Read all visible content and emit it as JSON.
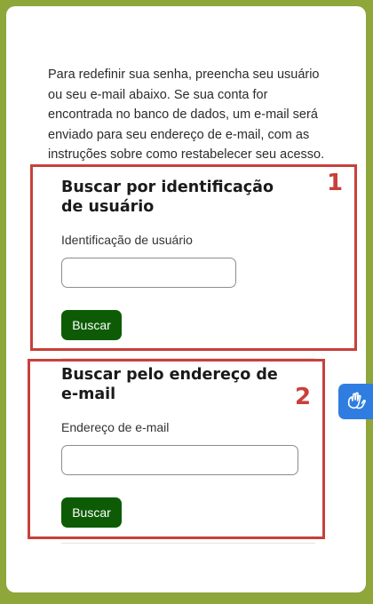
{
  "intro": {
    "text": "Para redefinir sua senha, preencha seu usuário ou seu e-mail abaixo. Se sua conta for encontrada no banco de dados, um e-mail será enviado para seu endereço de e-mail, com as instruções sobre como restabelecer seu acesso."
  },
  "username_section": {
    "title": "Buscar por identificação de usuário",
    "field_label": "Identificação de usuário",
    "field_value": "",
    "button_label": "Buscar"
  },
  "email_section": {
    "title": "Buscar pelo endereço de e-mail",
    "field_label": "Endereço de e-mail",
    "field_value": "",
    "button_label": "Buscar"
  },
  "annotations": {
    "marker_1": "1",
    "marker_2": "2",
    "color": "#c8403a"
  },
  "colors": {
    "page_background": "#8ea63a",
    "button": "#0d5c05",
    "accessibility_widget": "#2f7de1"
  },
  "accessibility_widget": {
    "icon": "sign-language-hands-icon"
  }
}
